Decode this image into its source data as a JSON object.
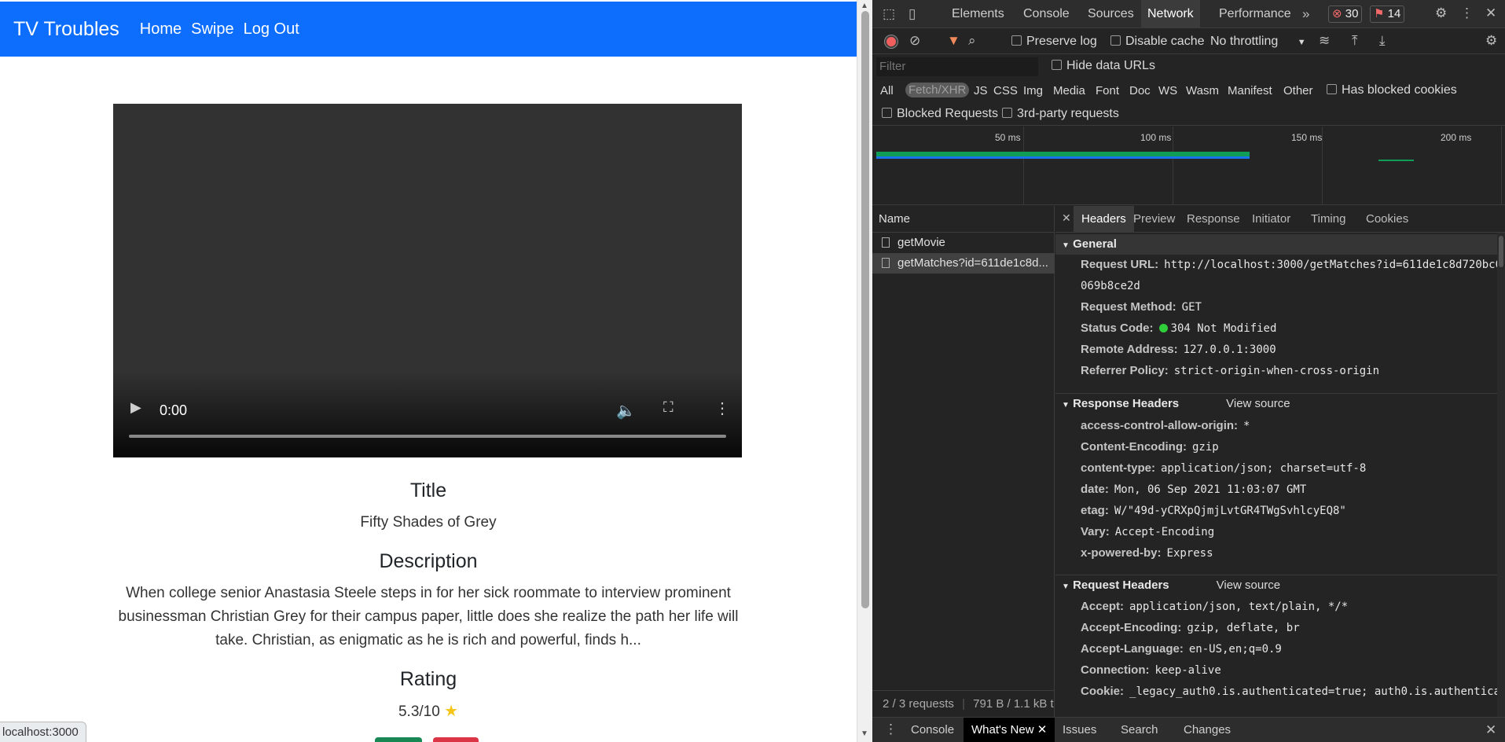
{
  "app": {
    "brand": "TV Troubles",
    "nav": [
      "Home",
      "Swipe",
      "Log Out"
    ],
    "video": {
      "time": "0:00"
    },
    "title_heading": "Title",
    "title_value": "Fifty Shades of Grey",
    "description_heading": "Description",
    "description_lines": [
      "When college senior Anastasia Steele steps in for her sick roommate to interview prominent",
      "businessman Christian Grey for their campus paper, little does she realize the path her life will",
      "take. Christian, as enigmatic as he is rich and powerful, finds h..."
    ],
    "rating_heading": "Rating",
    "rating_value": "5.3/10",
    "status_url": "localhost:3000"
  },
  "devtools": {
    "tabs": [
      "Elements",
      "Console",
      "Sources",
      "Network",
      "Performance"
    ],
    "active_tab": "Network",
    "error_count": "30",
    "warning_count": "14",
    "toolbar": {
      "preserve_log": "Preserve log",
      "disable_cache": "Disable cache",
      "throttling": "No throttling"
    },
    "filter_placeholder": "Filter",
    "hide_data_urls": "Hide data URLs",
    "types": [
      "All",
      "Fetch/XHR",
      "JS",
      "CSS",
      "Img",
      "Media",
      "Font",
      "Doc",
      "WS",
      "Wasm",
      "Manifest",
      "Other"
    ],
    "selected_type": "Fetch/XHR",
    "has_blocked_cookies": "Has blocked cookies",
    "blocked_requests": "Blocked Requests",
    "third_party": "3rd-party requests",
    "overview_labels": [
      "50 ms",
      "100 ms",
      "150 ms",
      "200 ms"
    ],
    "name_header": "Name",
    "requests": [
      "getMovie",
      "getMatches?id=611de1c8d..."
    ],
    "summary": "2 / 3 requests",
    "summary_size": "791 B / 1.1 kB t",
    "subtabs": [
      "Headers",
      "Preview",
      "Response",
      "Initiator",
      "Timing",
      "Cookies"
    ],
    "general": {
      "heading": "General",
      "rows": [
        {
          "k": "Request URL:",
          "v": "http://localhost:3000/getMatches?id=611de1c8d720bc0"
        },
        {
          "k": "",
          "v": "069b8ce2d"
        },
        {
          "k": "Request Method:",
          "v": "GET"
        },
        {
          "k": "Status Code:",
          "v": "304 Not Modified"
        },
        {
          "k": "Remote Address:",
          "v": "127.0.0.1:3000"
        },
        {
          "k": "Referrer Policy:",
          "v": "strict-origin-when-cross-origin"
        }
      ]
    },
    "response_headers": {
      "heading": "Response Headers",
      "view_source": "View source",
      "rows": [
        {
          "k": "access-control-allow-origin:",
          "v": "*"
        },
        {
          "k": "Content-Encoding:",
          "v": "gzip"
        },
        {
          "k": "content-type:",
          "v": "application/json; charset=utf-8"
        },
        {
          "k": "date:",
          "v": "Mon, 06 Sep 2021 11:03:07 GMT"
        },
        {
          "k": "etag:",
          "v": "W/\"49d-yCRXpQjmjLvtGR4TWgSvhlcyEQ8\""
        },
        {
          "k": "Vary:",
          "v": "Accept-Encoding"
        },
        {
          "k": "x-powered-by:",
          "v": "Express"
        }
      ]
    },
    "request_headers": {
      "heading": "Request Headers",
      "view_source": "View source",
      "rows": [
        {
          "k": "Accept:",
          "v": "application/json, text/plain, */*"
        },
        {
          "k": "Accept-Encoding:",
          "v": "gzip, deflate, br"
        },
        {
          "k": "Accept-Language:",
          "v": "en-US,en;q=0.9"
        },
        {
          "k": "Connection:",
          "v": "keep-alive"
        },
        {
          "k": "Cookie:",
          "v": "_legacy_auth0.is.authenticated=true; auth0.is.authentica"
        }
      ]
    },
    "drawer_tabs": [
      "Console",
      "What's New",
      "Issues",
      "Search",
      "Changes"
    ],
    "drawer_active": "What's New"
  }
}
